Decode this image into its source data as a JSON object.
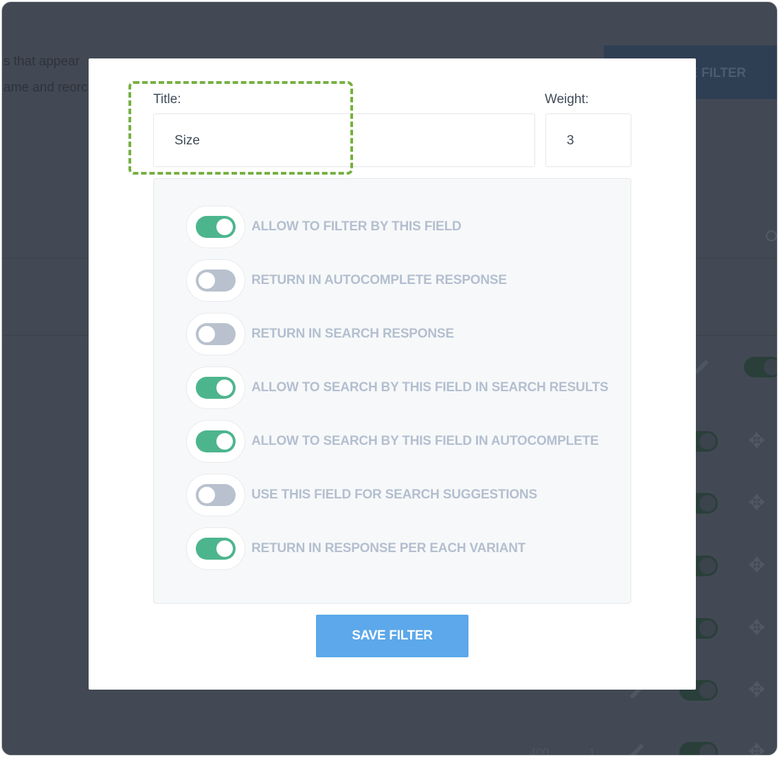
{
  "background": {
    "text_line_1": "s that appear",
    "text_line_2": "ame and reorc",
    "create_button_label": "E FILTER",
    "row_numbers": [
      "400",
      "1"
    ]
  },
  "modal": {
    "title_label": "Title:",
    "title_value": "Size",
    "weight_label": "Weight:",
    "weight_value": "3",
    "options": [
      {
        "label": "ALLOW TO FILTER BY THIS FIELD",
        "on": true
      },
      {
        "label": "RETURN IN AUTOCOMPLETE RESPONSE",
        "on": false
      },
      {
        "label": "RETURN IN SEARCH RESPONSE",
        "on": false
      },
      {
        "label": "ALLOW TO SEARCH BY THIS FIELD IN SEARCH RESULTS",
        "on": true
      },
      {
        "label": "ALLOW TO SEARCH BY THIS FIELD IN AUTOCOMPLETE",
        "on": true
      },
      {
        "label": "USE THIS FIELD FOR SEARCH SUGGESTIONS",
        "on": false
      },
      {
        "label": "RETURN IN RESPONSE PER EACH VARIANT",
        "on": true
      }
    ],
    "save_label": "SAVE FILTER"
  },
  "colors": {
    "toggle_on": "#4db58e",
    "toggle_off": "#b9c1ce",
    "save_button": "#5ca8ea",
    "highlight_border": "#76b041"
  },
  "icons": [
    "move-icon",
    "pencil-icon",
    "search-icon"
  ]
}
